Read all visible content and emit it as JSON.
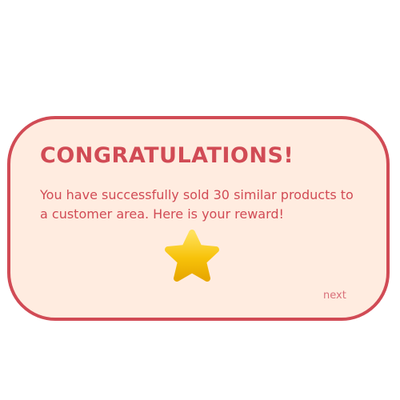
{
  "dialog": {
    "title": "CONGRATULATIONS!",
    "message": "You have successfully sold 30 similar products to a customer area. Here is your reward!",
    "reward_icon": "star-icon",
    "next_label": "next"
  },
  "colors": {
    "panel_background": "#ffece0",
    "accent": "#d14b55",
    "next_link": "#d9707a",
    "star_gold": "#f7c20a"
  }
}
